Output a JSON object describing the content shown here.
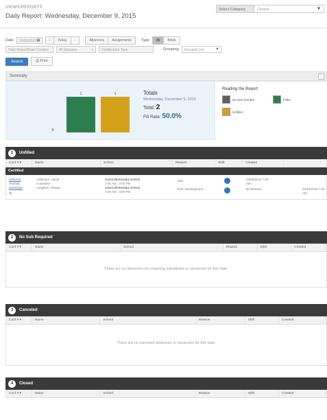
{
  "header": {
    "breadcrumb": "VIEWS/REPORTS",
    "title": "Daily Report: Wednesday, December 9, 2015",
    "category_label": "Select Category",
    "category_value": "Closed"
  },
  "filters": {
    "row1": {
      "date_label": "Date",
      "date_value": "12/09/2015",
      "prev": "‹",
      "today": "Today",
      "next": "›",
      "options": [
        "Absences",
        "Assignments"
      ],
      "view_label": "Type",
      "segments": [
        "All",
        "Block"
      ]
    },
    "row2": {
      "box1": "Daily Report/Date Created",
      "box2": "All Statuses",
      "box3": "Certification Type",
      "group_label": "Grouping",
      "group_value": "Grouped List"
    },
    "buttons": {
      "search": "Search",
      "print": "Print"
    }
  },
  "summary": {
    "label": "Summary",
    "collapse": "−",
    "chart_data": {
      "type": "bar",
      "categories": [
        "No Sub Needed",
        "Unfilled",
        "Filled"
      ],
      "values": [
        0,
        1,
        1
      ],
      "colors": [
        "#5e5e5e",
        "#2e7d4f",
        "#d4a21a"
      ],
      "data_labels": [
        "0",
        "1",
        "1"
      ],
      "ylim": [
        0,
        1
      ]
    },
    "totals": {
      "title": "Totals",
      "date": "Wednesday, December 9, 2015",
      "total_label": "Total:",
      "total_value": "2",
      "fill_label": "Fill Rate:",
      "fill_value": "50.0%"
    },
    "legend": {
      "title": "Reading the Report",
      "items": [
        {
          "label": "No Sub Needed",
          "color": "#5e5e5e"
        },
        {
          "label": "Filled",
          "color": "#2e7d4f"
        },
        {
          "label": "Unfilled",
          "color": "#d4a21a"
        }
      ]
    }
  },
  "sections": {
    "unfilled": {
      "number": "1",
      "title": "Unfilled",
      "columns": [
        "Conf # ▾",
        "Name",
        "School",
        "Reason",
        "Shift",
        "Created"
      ],
      "subhead": "Certified",
      "row": {
        "conf": "4861845",
        "conf_sub": "Partially",
        "conf_link2": "Substitute",
        "name": "Anderson, Sandi",
        "name_sub": "Counselor",
        "name_sub2": "Langston, Shawn",
        "school": "Jones Elementary School",
        "school_sub": "7:45 AM - 3:00 PM",
        "school2": "Jones Elementary School",
        "school2_sub": "7:45 AM - 3:00 PM",
        "reason": "Sick",
        "reason2": "Prof. Development",
        "created": "12/09/2015 7:00 AM",
        "created2": "No Reason",
        "right": "12/12/2015 7:00 AM",
        "edit_icon": "pencil-icon"
      }
    },
    "nosub": {
      "number": "2",
      "title": "No Sub Required",
      "columns": [
        "Conf # ▾",
        "Name",
        "School",
        "Reason",
        "Shift",
        "Created"
      ],
      "empty": "There are no absences not requiring substitutes or vacancies for this date."
    },
    "canceled": {
      "number": "3",
      "title": "Canceled",
      "columns": [
        "Conf # ▾",
        "Name",
        "School",
        "Reason",
        "Shift",
        "Created"
      ],
      "empty": "There are no canceled absences or vacancies for this date."
    },
    "closed": {
      "number": "4",
      "title": "Closed",
      "columns": [
        "Conf # ▾",
        "Name",
        "School",
        "Reason",
        "Shift",
        "Created"
      ]
    }
  }
}
